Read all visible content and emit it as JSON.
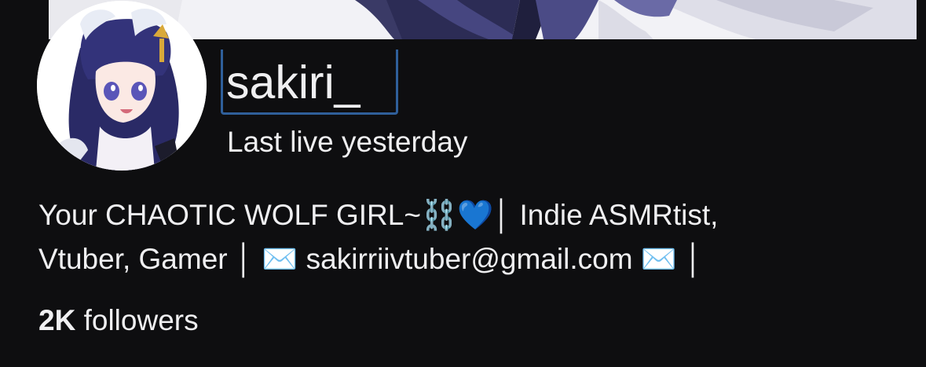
{
  "channel": {
    "name": "sakiri_",
    "last_live": "Last live yesterday",
    "bio_line1": "Your CHAOTIC WOLF GIRL~⛓️💙│ Indie ASMRtist,",
    "bio_line2": "Vtuber, Gamer │ ✉️ sakirriivtuber@gmail.com ✉️ │",
    "followers_count": "2K",
    "followers_label": "followers"
  },
  "colors": {
    "background": "#0e0e10",
    "text": "#efeff1",
    "name_highlight": "#2f5f9a"
  },
  "icons": [
    "chain-emoji-icon",
    "blue-heart-emoji-icon",
    "envelope-emoji-icon"
  ]
}
